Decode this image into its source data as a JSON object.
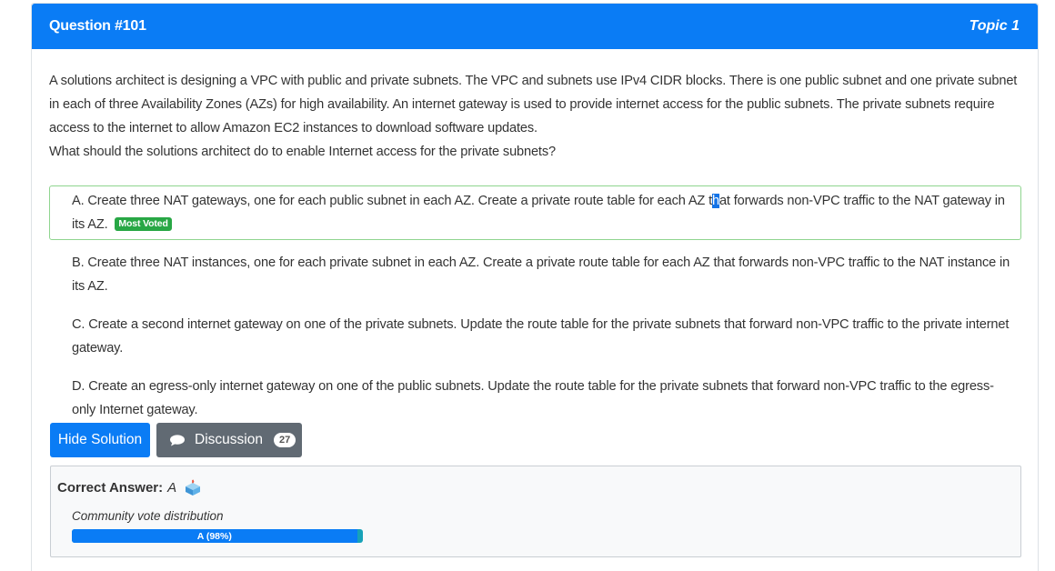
{
  "header": {
    "question_title": "Question #101",
    "topic": "Topic 1",
    "bg_color": "#0a7cf5"
  },
  "question": {
    "paragraph1": "A solutions architect is designing a VPC with public and private subnets. The VPC and subnets use IPv4 CIDR blocks. There is one public subnet and one private subnet in each of three Availability Zones (AZs) for high availability. An internet gateway is used to provide internet access for the public subnets. The private subnets require access to the internet to allow Amazon EC2 instances to download software updates.",
    "paragraph2": "What should the solutions architect do to enable Internet access for the private subnets?"
  },
  "choices": {
    "a_before": "A. Create three NAT gateways, one for each public subnet in each AZ. Create a private route table for each AZ t",
    "a_highlight": "h",
    "a_after": "at forwards non-VPC traffic to the NAT gateway in its AZ.",
    "a_badge": "Most Voted",
    "b": "B. Create three NAT instances, one for each private subnet in each AZ. Create a private route table for each AZ that forwards non-VPC traffic to the NAT instance in its AZ.",
    "c": "C. Create a second internet gateway on one of the private subnets. Update the route table for the private subnets that forward non-VPC traffic to the private internet gateway.",
    "d": "D. Create an egress-only internet gateway on one of the public subnets. Update the route table for the private subnets that forward non-VPC traffic to the egress-only Internet gateway."
  },
  "buttons": {
    "hide_solution": "Hide Solution",
    "discussion": "Discussion",
    "discussion_count": "27",
    "chat_icon": "speech-bubble-icon"
  },
  "answer": {
    "label": "Correct Answer:",
    "value": "A",
    "vote_icon": "ballot-box-icon",
    "distribution_label": "Community vote distribution",
    "bar_text": "A (98%)",
    "bar_percent": 98,
    "bar_color": "#0a7cf5",
    "bar_rest_color": "#17a2b8"
  }
}
